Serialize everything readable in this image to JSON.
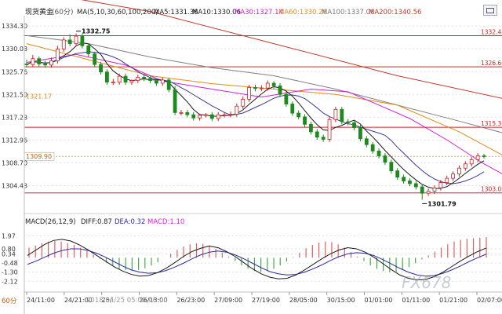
{
  "header": {
    "symbol_label": "现货黄金",
    "period_label": "(60分)",
    "ma_prefix": "MA(5,10,30,60,100,200)",
    "ma_items": [
      {
        "label": "MA5:1331.36",
        "color": "#1a1a1a"
      },
      {
        "label": "MA10:1330.06",
        "color": "#1a1a1a"
      },
      {
        "label": "MA30:1327.14",
        "color": "#d11fd1"
      },
      {
        "label": "MA60:1330.26",
        "color": "#e08a17"
      },
      {
        "label": "MA100:1337.06",
        "color": "#777777"
      },
      {
        "label": "MA200:1340.56",
        "color": "#c0392b"
      }
    ]
  },
  "macd_header": {
    "prefix": "MACD(26,12,9)",
    "items": [
      {
        "label": "DIFF:0.87",
        "color": "#1a1a1a"
      },
      {
        "label": "DEA:0.32",
        "color": "#2a2aa0"
      },
      {
        "label": "MACD:1.10",
        "color": "#d11fd1"
      }
    ]
  },
  "period_corner": "60分",
  "date_range_overlay": "2018/04/25 05:00-06:00",
  "watermark": "FX678",
  "colors": {
    "up": "#d42020",
    "down": "#1e8a1e",
    "level": "#d42020",
    "grid": "#e0e0e0"
  },
  "chart_data": [
    {
      "type": "candlestick",
      "y_ticks": [
        1334.3,
        1330.03,
        1325.76,
        1321.5,
        1317.23,
        1312.96,
        1308.7,
        1304.43
      ],
      "ylim": [
        1299.5,
        1335.5
      ],
      "x_tick_labels": [
        "24/11:00",
        "24/21:00",
        "25/",
        "26/13:00",
        "26/23:00",
        "27/09:00",
        "27/19:00",
        "28/05:00",
        "30/15:00",
        "01/01:00",
        "01/11:00",
        "01/21:00",
        "02/07:00"
      ],
      "horizontal_levels": [
        1332.48,
        1326.66,
        1315.36,
        1303.07
      ],
      "current_price_line": 1309.9,
      "left_annotation": 1321.17,
      "annotations": [
        {
          "text": "1332.75",
          "value": 1332.75,
          "kind": "high"
        },
        {
          "text": "1301.79",
          "value": 1301.79,
          "kind": "low"
        }
      ],
      "series": [
        {
          "name": "MA200",
          "color": "#c0392b",
          "x": [
            0,
            20,
            40,
            60,
            78
          ],
          "y": [
            1341.0,
            1337.0,
            1331.0,
            1325.0,
            1320.5
          ]
        },
        {
          "name": "MA100",
          "color": "#808080",
          "x": [
            0,
            10,
            20,
            30,
            40,
            50,
            60,
            70,
            78
          ],
          "y": [
            1332.5,
            1331.0,
            1328.5,
            1326.5,
            1325.0,
            1322.5,
            1319.5,
            1316.5,
            1314.0
          ]
        },
        {
          "name": "MA60",
          "color": "#e08a17",
          "x": [
            0,
            10,
            20,
            30,
            40,
            50,
            60,
            70,
            78
          ],
          "y": [
            1331.0,
            1328.0,
            1325.0,
            1323.5,
            1322.5,
            1321.5,
            1319.5,
            1314.5,
            1309.5
          ]
        },
        {
          "name": "MA30",
          "color": "#d11fd1",
          "x": [
            0,
            8,
            16,
            22,
            30,
            38,
            46,
            52,
            58,
            62,
            68,
            74,
            78
          ],
          "y": [
            1327.5,
            1329.0,
            1327.0,
            1324.0,
            1322.5,
            1321.0,
            1322.5,
            1322.0,
            1319.0,
            1317.0,
            1313.0,
            1308.5,
            1306.0
          ]
        }
      ],
      "candles_o": [
        1327.2,
        1327.1,
        1328.2,
        1327.2,
        1327.0,
        1327.8,
        1330.0,
        1331.7,
        1331.0,
        1332.4,
        1330.6,
        1329.1,
        1327.1,
        1325.7,
        1323.8,
        1323.8,
        1324.9,
        1323.8,
        1324.1,
        1324.7,
        1324.5,
        1324.1,
        1323.6,
        1324.2,
        1322.4,
        1318.1,
        1318.1,
        1317.7,
        1317.1,
        1317.6,
        1317.7,
        1317.0,
        1317.7,
        1317.7,
        1317.8,
        1319.3,
        1320.6,
        1322.8,
        1322.6,
        1322.7,
        1323.6,
        1323.1,
        1321.5,
        1319.7,
        1318.0,
        1317.3,
        1315.9,
        1314.5,
        1313.5,
        1313.1,
        1316.8,
        1318.7,
        1316.4,
        1316.2,
        1315.3,
        1313.2,
        1312.1,
        1310.9,
        1310.0,
        1308.8,
        1307.2,
        1306.0,
        1305.3,
        1304.8,
        1304.2,
        1303.0,
        1303.4,
        1304.0,
        1305.0,
        1305.8,
        1306.6,
        1307.7,
        1308.5,
        1309.3,
        1310.0
      ],
      "candles_c": [
        1327.1,
        1328.2,
        1327.2,
        1327.0,
        1327.8,
        1330.0,
        1331.7,
        1331.0,
        1332.4,
        1330.6,
        1329.1,
        1327.1,
        1325.7,
        1323.8,
        1323.8,
        1324.9,
        1323.8,
        1324.1,
        1324.7,
        1324.5,
        1324.1,
        1323.6,
        1324.2,
        1322.4,
        1318.1,
        1318.1,
        1317.7,
        1317.1,
        1317.6,
        1317.7,
        1317.0,
        1317.7,
        1317.7,
        1317.8,
        1319.3,
        1320.6,
        1322.8,
        1322.6,
        1322.7,
        1323.6,
        1323.1,
        1321.5,
        1319.7,
        1318.0,
        1317.3,
        1315.9,
        1314.5,
        1313.5,
        1313.1,
        1316.8,
        1318.7,
        1316.4,
        1316.2,
        1315.3,
        1313.2,
        1312.1,
        1310.9,
        1310.0,
        1308.8,
        1307.2,
        1306.0,
        1305.3,
        1304.8,
        1304.2,
        1303.0,
        1303.4,
        1304.0,
        1305.0,
        1305.8,
        1306.6,
        1307.7,
        1308.5,
        1309.3,
        1310.0,
        1309.9
      ],
      "candles_h": [
        1328.0,
        1328.9,
        1328.6,
        1327.8,
        1328.4,
        1330.6,
        1332.2,
        1332.75,
        1332.9,
        1332.9,
        1331.1,
        1329.5,
        1327.6,
        1326.2,
        1324.4,
        1325.4,
        1325.4,
        1324.3,
        1325.2,
        1325.2,
        1325.0,
        1324.5,
        1324.6,
        1324.6,
        1323.1,
        1318.6,
        1318.6,
        1318.2,
        1317.9,
        1318.0,
        1318.2,
        1318.2,
        1318.2,
        1318.3,
        1319.8,
        1321.1,
        1323.3,
        1323.3,
        1323.2,
        1324.1,
        1324.0,
        1323.6,
        1322.0,
        1320.2,
        1318.5,
        1317.8,
        1316.4,
        1315.0,
        1314.0,
        1317.3,
        1319.2,
        1319.2,
        1316.9,
        1316.7,
        1315.8,
        1313.7,
        1312.6,
        1311.4,
        1310.5,
        1309.3,
        1307.7,
        1306.5,
        1305.8,
        1305.3,
        1304.7,
        1303.9,
        1304.5,
        1305.5,
        1306.3,
        1307.1,
        1308.2,
        1309.0,
        1309.8,
        1310.5,
        1310.4
      ],
      "candles_l": [
        1326.6,
        1326.6,
        1326.7,
        1326.5,
        1326.5,
        1327.3,
        1329.5,
        1330.5,
        1330.5,
        1330.1,
        1328.6,
        1326.6,
        1325.2,
        1323.3,
        1323.3,
        1323.3,
        1323.3,
        1323.3,
        1323.6,
        1324.0,
        1323.6,
        1323.1,
        1323.1,
        1321.9,
        1317.6,
        1317.6,
        1317.2,
        1316.6,
        1316.6,
        1317.2,
        1316.5,
        1316.5,
        1317.2,
        1317.2,
        1317.3,
        1318.8,
        1320.1,
        1322.1,
        1322.1,
        1322.2,
        1322.6,
        1321.0,
        1319.2,
        1317.5,
        1316.8,
        1315.4,
        1314.0,
        1313.0,
        1312.6,
        1312.6,
        1316.3,
        1315.9,
        1315.7,
        1314.8,
        1312.7,
        1311.6,
        1310.4,
        1309.5,
        1308.3,
        1306.7,
        1305.5,
        1304.8,
        1304.3,
        1303.7,
        1301.79,
        1302.5,
        1302.9,
        1303.5,
        1304.5,
        1305.3,
        1306.1,
        1307.2,
        1308.0,
        1308.8,
        1309.5
      ]
    },
    {
      "type": "macd",
      "y_ticks": [
        1.97,
        0.8,
        0.34,
        -0.48,
        -1.3,
        -2.12
      ],
      "ylim": [
        -2.8,
        2.7
      ],
      "series": [
        {
          "name": "DIFF",
          "color": "#1a1a1a"
        },
        {
          "name": "DEA",
          "color": "#2a2aa0"
        }
      ],
      "histogram": [
        0.9,
        1.1,
        1.3,
        1.45,
        1.5,
        1.45,
        1.3,
        1.15,
        0.9,
        0.6,
        0.25,
        -0.1,
        -0.45,
        -0.75,
        -1.0,
        -1.1,
        -1.15,
        -1.1,
        -0.95,
        -0.7,
        -0.4,
        0.0,
        0.35,
        0.7,
        1.0,
        1.2,
        1.3,
        1.25,
        1.1,
        0.8,
        0.45,
        0.1,
        -0.3,
        -0.7,
        -1.0,
        -1.2,
        -1.3,
        -1.2,
        -1.0,
        -0.7,
        -0.35,
        0.05,
        0.45,
        0.85,
        1.15,
        1.35,
        1.45,
        1.4,
        1.2,
        0.9,
        0.5,
        0.1,
        -0.3,
        -0.7,
        -1.0,
        -1.2,
        -1.3,
        -1.25,
        -1.1,
        -0.85,
        -0.5,
        -0.15,
        0.2,
        0.55,
        0.9,
        1.2,
        1.45,
        1.6,
        1.7,
        1.75,
        1.8,
        1.85
      ],
      "diff": [
        0.2,
        0.7,
        1.2,
        1.55,
        1.65,
        1.5,
        1.15,
        0.7,
        0.2,
        -0.3,
        -0.8,
        -1.2,
        -1.5,
        -1.65,
        -1.6,
        -1.35,
        -0.95,
        -0.45,
        0.1,
        0.55,
        0.85,
        1.05,
        0.9,
        0.55,
        0.1,
        -0.45,
        -1.0,
        -1.45,
        -1.75,
        -1.9,
        -1.85,
        -1.55,
        -1.1,
        -0.6,
        -0.1,
        0.35,
        0.7,
        0.9,
        0.8,
        0.5,
        0.05,
        -0.5,
        -1.05,
        -1.55,
        -1.85,
        -2.0,
        -1.95,
        -1.7,
        -1.3,
        -0.8,
        -0.3,
        0.15,
        0.55,
        0.87
      ],
      "dea": [
        -0.6,
        -0.3,
        0.05,
        0.4,
        0.65,
        0.8,
        0.8,
        0.65,
        0.4,
        0.05,
        -0.35,
        -0.75,
        -1.1,
        -1.3,
        -1.4,
        -1.35,
        -1.15,
        -0.85,
        -0.5,
        -0.1,
        0.25,
        0.5,
        0.6,
        0.5,
        0.25,
        -0.1,
        -0.5,
        -0.9,
        -1.25,
        -1.45,
        -1.55,
        -1.5,
        -1.3,
        -1.0,
        -0.65,
        -0.25,
        0.1,
        0.35,
        0.45,
        0.4,
        0.2,
        -0.15,
        -0.55,
        -0.95,
        -1.3,
        -1.55,
        -1.65,
        -1.6,
        -1.4,
        -1.1,
        -0.75,
        -0.35,
        0.0,
        0.32
      ]
    }
  ]
}
